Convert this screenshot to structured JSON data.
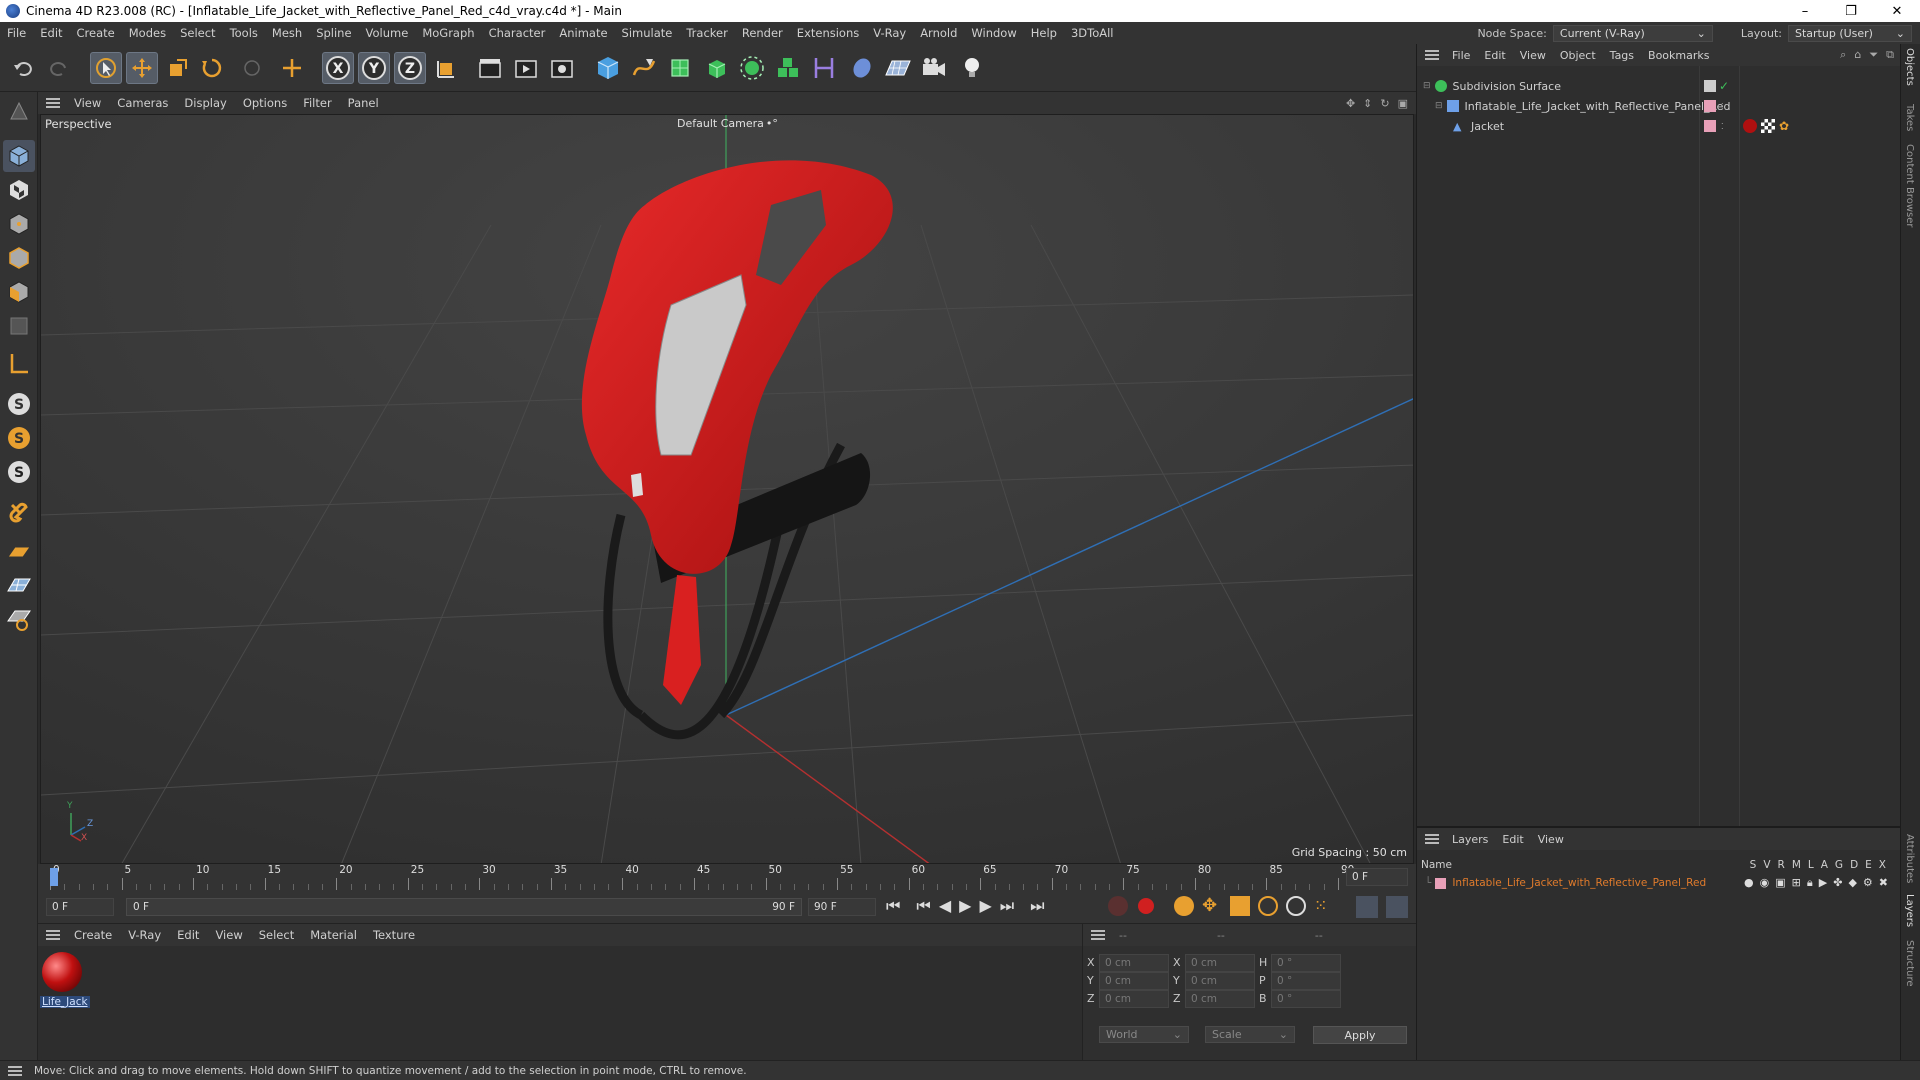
{
  "window": {
    "title": "Cinema 4D R23.008 (RC) - [Inflatable_Life_Jacket_with_Reflective_Panel_Red_c4d_vray.c4d *] - Main",
    "minimize": "–",
    "maximize": "❐",
    "close": "✕"
  },
  "menubar": {
    "items": [
      "File",
      "Edit",
      "Create",
      "Modes",
      "Select",
      "Tools",
      "Mesh",
      "Spline",
      "Volume",
      "MoGraph",
      "Character",
      "Animate",
      "Simulate",
      "Tracker",
      "Render",
      "Extensions",
      "V-Ray",
      "Arnold",
      "Window",
      "Help",
      "3DToAll"
    ],
    "node_space_label": "Node Space:",
    "node_space_value": "Current (V-Ray)",
    "layout_label": "Layout:",
    "layout_value": "Startup (User)"
  },
  "viewport": {
    "menu": [
      "View",
      "Cameras",
      "Display",
      "Options",
      "Filter",
      "Panel"
    ],
    "view_name": "Perspective",
    "camera_name": "Default Camera",
    "camera_suffix": "•°",
    "grid_spacing": "Grid Spacing : 50 cm",
    "axis_y": "Y",
    "axis_z": "Z",
    "axis_x": "X"
  },
  "timeline": {
    "ticks": [
      "0",
      "5",
      "10",
      "15",
      "20",
      "25",
      "30",
      "35",
      "40",
      "45",
      "50",
      "55",
      "60",
      "65",
      "70",
      "75",
      "80",
      "85",
      "90"
    ],
    "current_frame": "0 F"
  },
  "transport": {
    "start_field": "0 F",
    "range_start": "0 F",
    "range_end": "90 F",
    "end_field": "90 F"
  },
  "material_bar": {
    "menu": [
      "Create",
      "V-Ray",
      "Edit",
      "View",
      "Select",
      "Material",
      "Texture"
    ],
    "material_name": "Life_Jack"
  },
  "coords": {
    "col_headers": [
      "--",
      "--",
      "--"
    ],
    "rows": [
      {
        "a": "X",
        "av": "0 cm",
        "b": "X",
        "bv": "0 cm",
        "c": "H",
        "cv": "0 °"
      },
      {
        "a": "Y",
        "av": "0 cm",
        "b": "Y",
        "bv": "0 cm",
        "c": "P",
        "cv": "0 °"
      },
      {
        "a": "Z",
        "av": "0 cm",
        "b": "Z",
        "bv": "0 cm",
        "c": "B",
        "cv": "0 °"
      }
    ],
    "space": "World",
    "mode": "Scale",
    "apply": "Apply"
  },
  "object_manager": {
    "menu": [
      "File",
      "Edit",
      "View",
      "Object",
      "Tags",
      "Bookmarks"
    ],
    "objects": [
      {
        "name": "Subdivision Surface"
      },
      {
        "name": "Inflatable_Life_Jacket_with_Reflective_Panel_Red"
      },
      {
        "name": "Jacket"
      }
    ]
  },
  "layer_manager": {
    "menu": [
      "Layers",
      "Edit",
      "View"
    ],
    "name_header": "Name",
    "flag_headers": [
      "S",
      "V",
      "R",
      "M",
      "L",
      "A",
      "G",
      "D",
      "E",
      "X"
    ],
    "layer_name": "Inflatable_Life_Jacket_with_Reflective_Panel_Red"
  },
  "side_tabs": [
    "Objects",
    "Takes",
    "Content Browser",
    "Attributes",
    "Layers",
    "Structure"
  ],
  "status": {
    "text": "Move: Click and drag to move elements. Hold down SHIFT to quantize movement / add to the selection in point mode, CTRL to remove."
  },
  "colors": {
    "accent_orange": "#e07b2c",
    "jacket_red": "#d41a1a",
    "layer_pink": "#e8a0b8"
  }
}
